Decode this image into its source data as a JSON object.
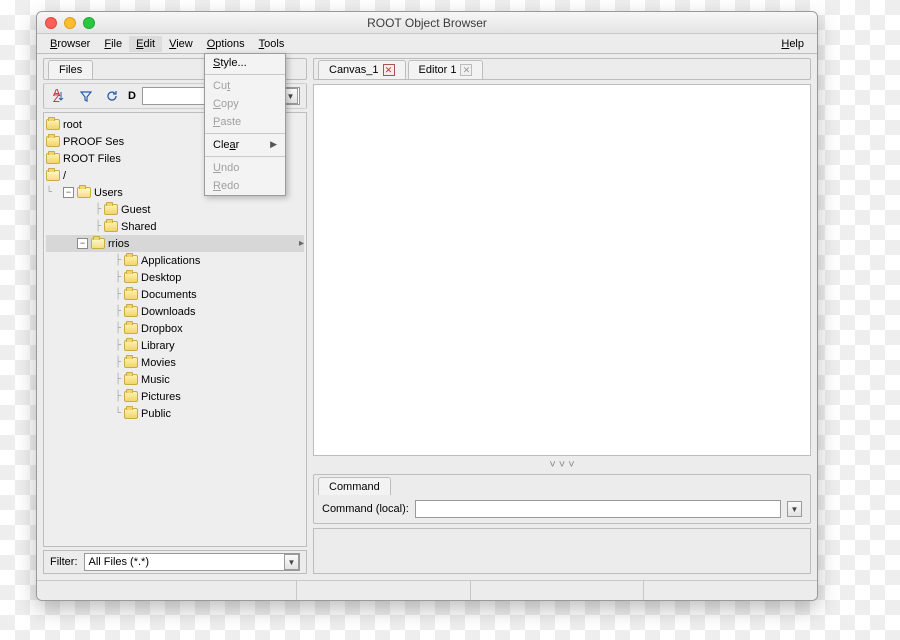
{
  "window": {
    "title": "ROOT Object Browser"
  },
  "menubar": {
    "browser": "Browser",
    "file": "File",
    "edit": "Edit",
    "view": "View",
    "options": "Options",
    "tools": "Tools",
    "help": "Help"
  },
  "editmenu": {
    "style": "Style...",
    "cut": "Cut",
    "copy": "Copy",
    "paste": "Paste",
    "clear": "Clear",
    "undo": "Undo",
    "redo": "Redo"
  },
  "left": {
    "tab": "Files",
    "toolbar_label": "D",
    "filter_label": "Filter:",
    "filter_value": "All Files (*.*)"
  },
  "tree": {
    "root": "root",
    "proof": "PROOF Sessions",
    "rootfiles": "ROOT Files",
    "slash": "/",
    "users": "Users",
    "guest": "Guest",
    "shared": "Shared",
    "rrios": "rrios",
    "applications": "Applications",
    "desktop": "Desktop",
    "documents": "Documents",
    "downloads": "Downloads",
    "dropbox": "Dropbox",
    "library": "Library",
    "movies": "Movies",
    "music": "Music",
    "pictures": "Pictures",
    "public": "Public"
  },
  "right": {
    "canvas_tab": "Canvas_1",
    "editor_tab": "Editor 1",
    "command_tab": "Command",
    "command_label": "Command (local):"
  }
}
